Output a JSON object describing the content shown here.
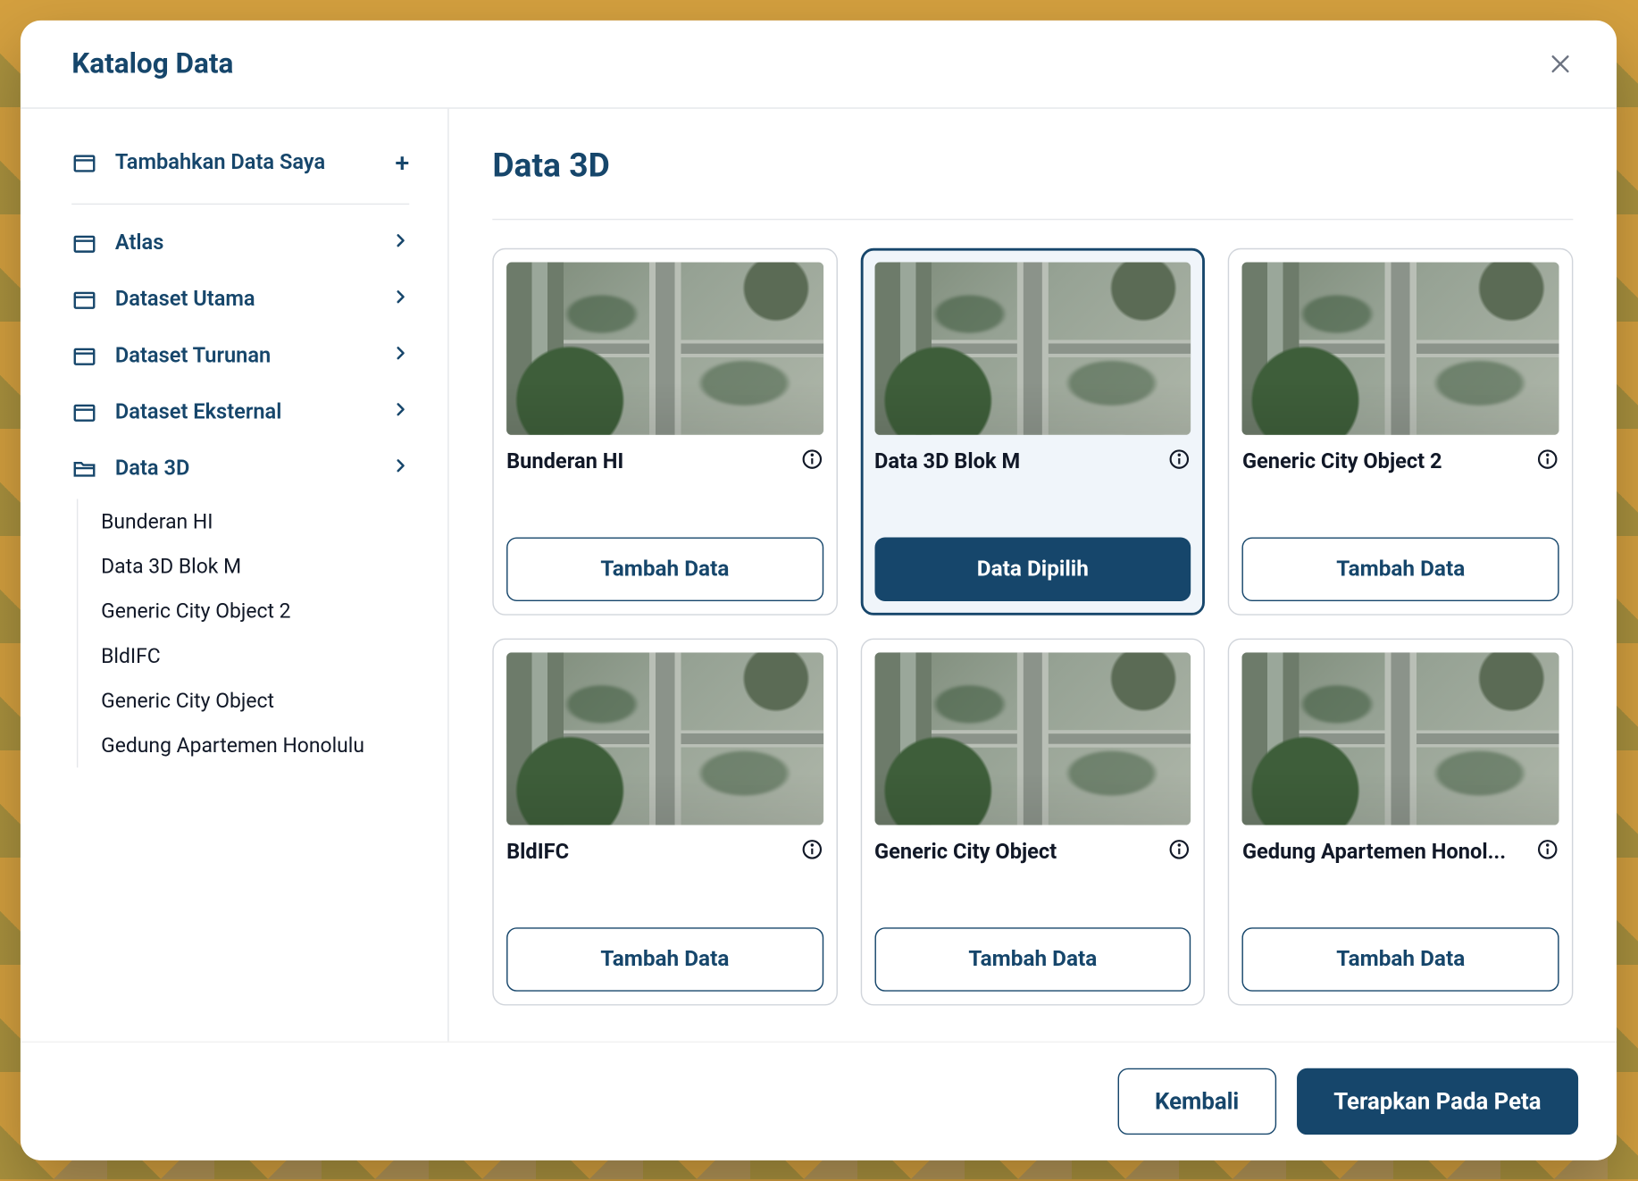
{
  "modal": {
    "title": "Katalog Data"
  },
  "sidebar": {
    "add_my_data": "Tambahkan Data Saya",
    "items": [
      {
        "label": "Atlas"
      },
      {
        "label": "Dataset Utama"
      },
      {
        "label": "Dataset Turunan"
      },
      {
        "label": "Dataset Eksternal"
      },
      {
        "label": "Data 3D"
      }
    ],
    "children": [
      "Bunderan HI",
      "Data 3D Blok M",
      "Generic City Object 2",
      "BldIFC",
      "Generic City Object",
      "Gedung Apartemen Honolulu"
    ]
  },
  "content": {
    "title": "Data 3D",
    "add_label": "Tambah Data",
    "selected_label": "Data Dipilih",
    "cards": [
      {
        "title": "Bunderan HI",
        "selected": false
      },
      {
        "title": "Data 3D Blok M",
        "selected": true
      },
      {
        "title": "Generic City Object 2",
        "selected": false
      },
      {
        "title": "BldIFC",
        "selected": false
      },
      {
        "title": "Generic City Object",
        "selected": false
      },
      {
        "title": "Gedung Apartemen Honol...",
        "selected": false
      }
    ]
  },
  "footer": {
    "back": "Kembali",
    "apply": "Terapkan Pada Peta"
  }
}
